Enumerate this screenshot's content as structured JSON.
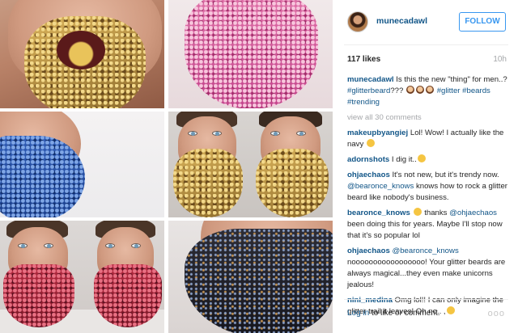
{
  "post": {
    "username": "munecadawl",
    "follow_label": "FOLLOW",
    "likes": "117 likes",
    "age": "10h"
  },
  "caption": {
    "user": "munecadawl",
    "text": " Is this the new \"thing\" for men..? ",
    "tag1": "#glitterbeard",
    "text2": "??? ",
    "tag2": "#glitter",
    "tag3": "#beards",
    "tag4": "#trending"
  },
  "view_all": "view all 30 comments",
  "comments": [
    {
      "user": "makeupbyangiej",
      "text": " Lol! Wow! I actually like the navy "
    },
    {
      "user": "adornshots",
      "text": " I dig it.."
    },
    {
      "user": "ohjaechaos",
      "text": " It's not new, but it's trendy now. ",
      "mention": "@bearonce_knows",
      "text2": " knows how to rock a glitter beard like nobody's business."
    },
    {
      "user": "bearonce_knows",
      "text": " thanks ",
      "mention": "@ohjaechaos",
      "text2": " been doing this for years. Maybe I'll stop now that it's so popular lol"
    },
    {
      "user": "ohjaechaos",
      "mention": " @bearonce_knows",
      "text2": " nooooooooooooooooo! Your glitter beards are always magical...they even make unicorns jealous!"
    },
    {
      "user": "nini_medina",
      "text": " Omg lol!! I can only imagine the glitter trail it leaves! Oh no.. ,"
    }
  ],
  "footer": {
    "login_link": "Log in",
    "login_text": " to like or comment.",
    "more": "ooo"
  }
}
